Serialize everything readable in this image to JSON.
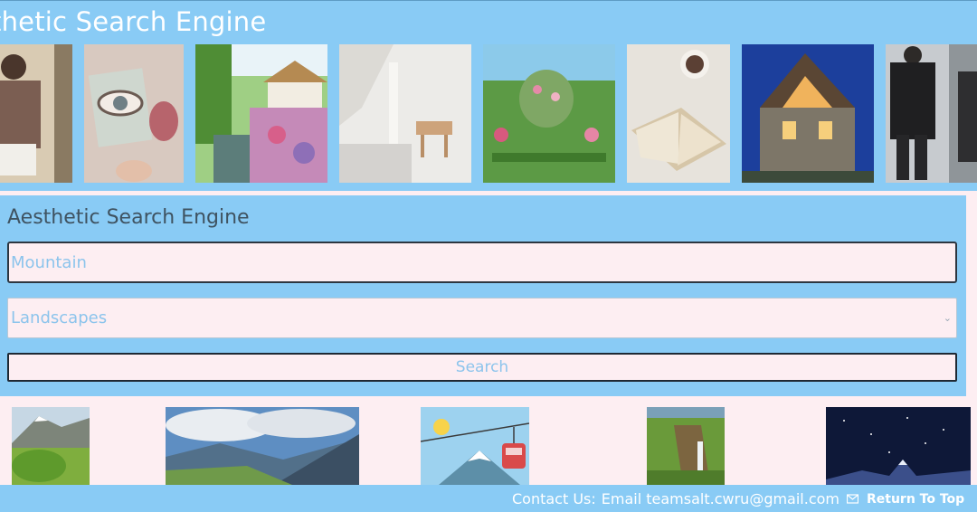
{
  "header": {
    "title": "thetic Search Engine"
  },
  "gallery": [
    {
      "icon": "fashion-photo"
    },
    {
      "icon": "eye-painting-photo"
    },
    {
      "icon": "cottage-garden-photo"
    },
    {
      "icon": "white-interior-photo"
    },
    {
      "icon": "rose-garden-photo"
    },
    {
      "icon": "open-book-photo"
    },
    {
      "icon": "modern-house-photo"
    },
    {
      "icon": "menswear-photo"
    }
  ],
  "search": {
    "heading": "Aesthetic Search Engine",
    "query_value": "Mountain",
    "category_value": "Landscapes",
    "button_label": "Search"
  },
  "results": [
    {
      "icon": "grassy-mountain-photo"
    },
    {
      "icon": "alpine-valley-photo"
    },
    {
      "icon": "cable-car-illustration"
    },
    {
      "icon": "waterfall-cliff-photo"
    },
    {
      "icon": "starry-mountain-photo"
    }
  ],
  "footer": {
    "contact_label": "Contact Us:",
    "email_text": "Email teamsalt.cwru@gmail.com",
    "return_label": "Return To Top"
  },
  "colors": {
    "header_bg": "#89cbf5",
    "page_bg": "#fdeef2",
    "input_text": "#8cc4ec"
  }
}
